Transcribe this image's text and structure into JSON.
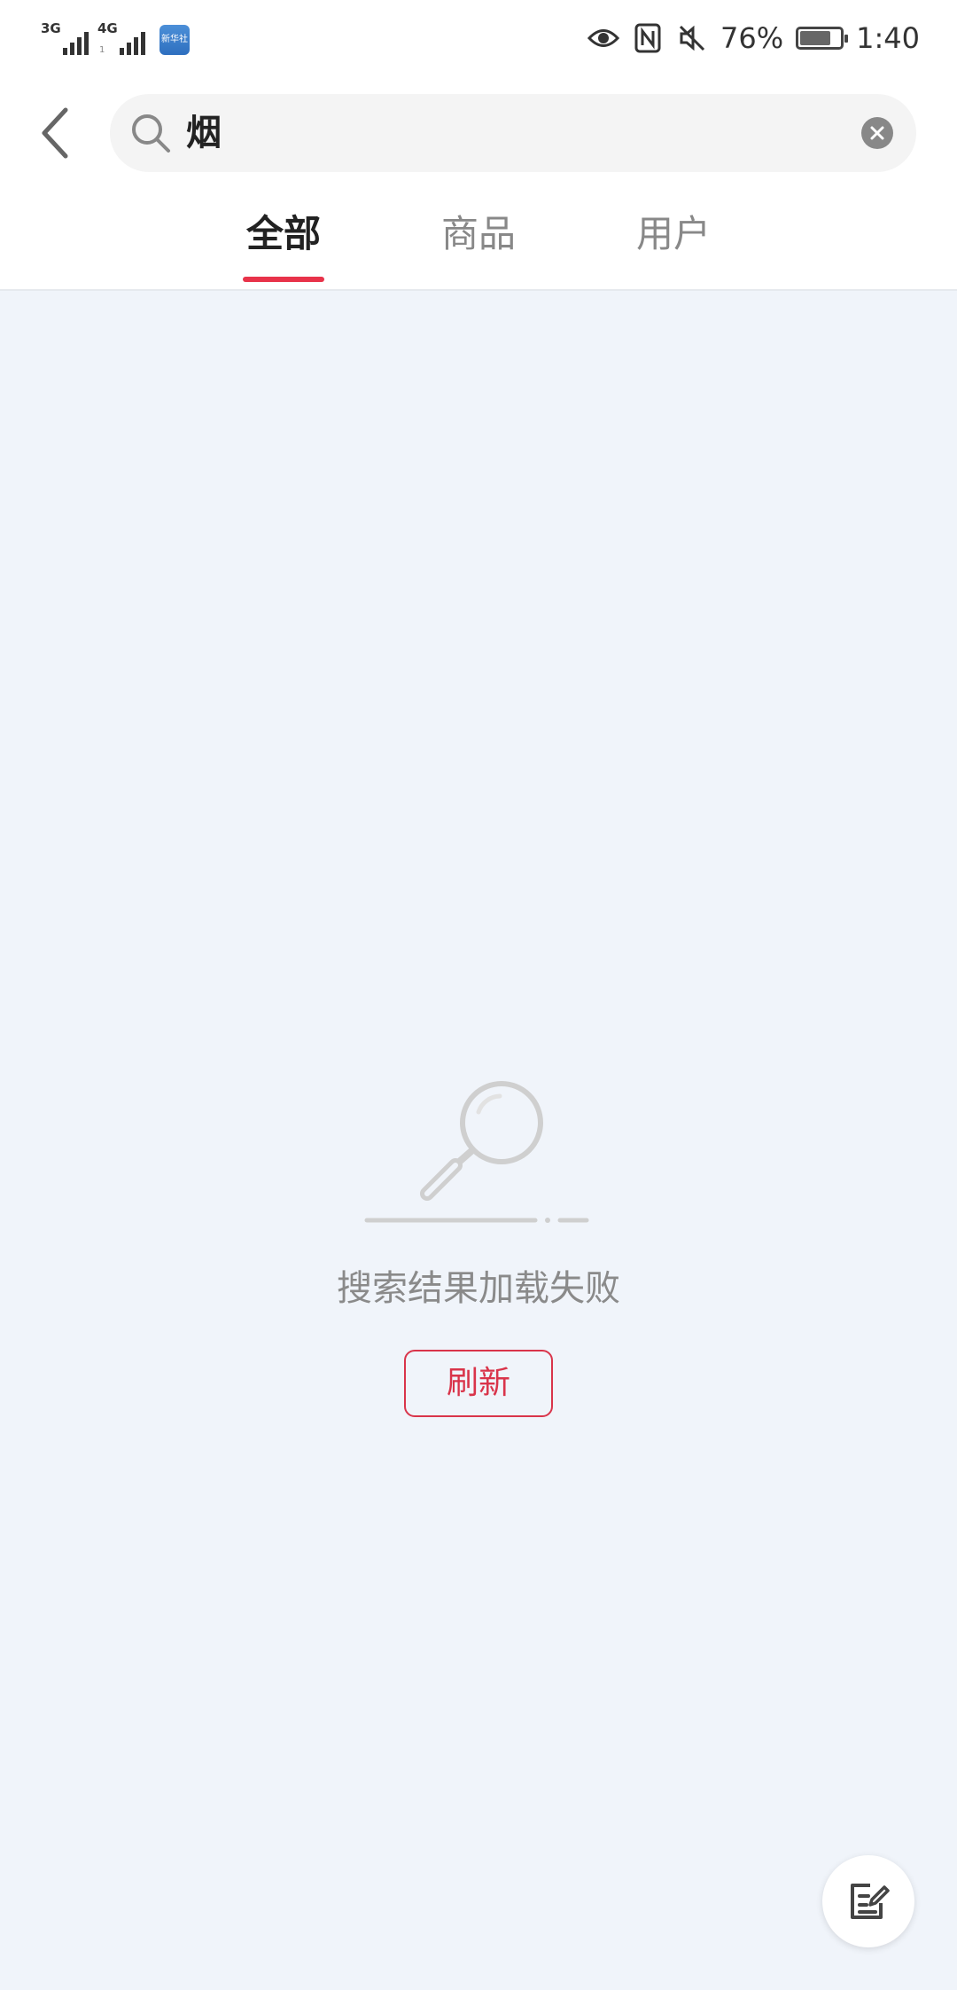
{
  "status_bar": {
    "net1": "3G",
    "net2": "4G",
    "net2_sub": "1",
    "app_badge": "新华社",
    "battery_percent": "76%",
    "battery_level": 0.76,
    "time": "1:40",
    "icons": [
      "eye-icon",
      "nfc-icon",
      "mute-icon",
      "battery-icon"
    ]
  },
  "header": {
    "search_value": "烟"
  },
  "tabs": [
    {
      "label": "全部",
      "active": true
    },
    {
      "label": "商品",
      "active": false
    },
    {
      "label": "用户",
      "active": false
    }
  ],
  "empty_state": {
    "message": "搜索结果加载失败",
    "refresh_label": "刷新"
  },
  "colors": {
    "accent": "#e8334a",
    "page_bg": "#f0f4fa"
  }
}
